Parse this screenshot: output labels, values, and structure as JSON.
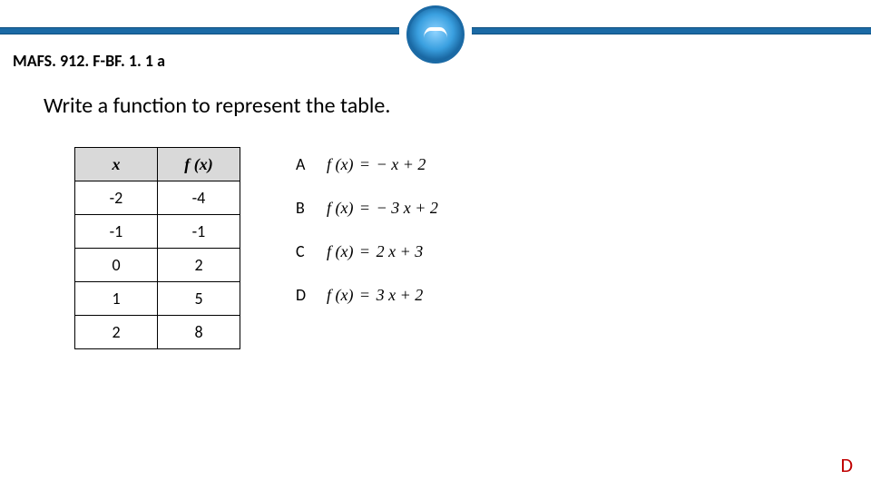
{
  "header": {
    "standard_code": "MAFS. 912. F-BF. 1. 1 a"
  },
  "prompt": "Write a function to represent the table.",
  "table": {
    "headers": {
      "x": "x",
      "fx": "f (x)"
    },
    "rows": [
      {
        "x": "-2",
        "fx": "-4"
      },
      {
        "x": "-1",
        "fx": "-1"
      },
      {
        "x": "0",
        "fx": "2"
      },
      {
        "x": "1",
        "fx": "5"
      },
      {
        "x": "2",
        "fx": "8"
      }
    ]
  },
  "choices": [
    {
      "letter": "A",
      "lhs": "f (x)",
      "rhs": "− x  + 2"
    },
    {
      "letter": "B",
      "lhs": "f (x)",
      "rhs": "− 3 x  + 2"
    },
    {
      "letter": "C",
      "lhs": "f (x)",
      "rhs": "2 x  +  3"
    },
    {
      "letter": "D",
      "lhs": "f (x)",
      "rhs": "3 x  +  2"
    }
  ],
  "answer": "D",
  "chart_data": {
    "type": "table",
    "columns": [
      "x",
      "f(x)"
    ],
    "rows": [
      [
        -2,
        -4
      ],
      [
        -1,
        -1
      ],
      [
        0,
        2
      ],
      [
        1,
        5
      ],
      [
        2,
        8
      ]
    ]
  }
}
